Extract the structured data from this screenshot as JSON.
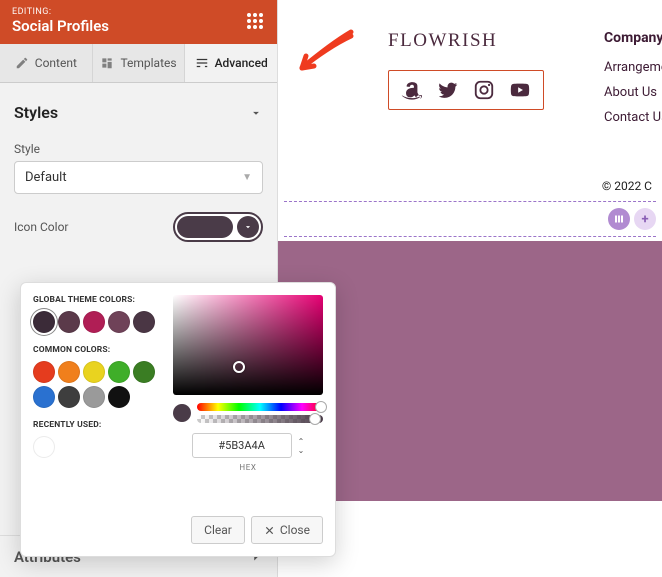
{
  "header": {
    "editing_label": "EDITING:",
    "title": "Social Profiles"
  },
  "tabs": {
    "content": "Content",
    "templates": "Templates",
    "advanced": "Advanced"
  },
  "styles": {
    "section_title": "Styles",
    "style_label": "Style",
    "style_value": "Default",
    "icon_color_label": "Icon Color"
  },
  "attributes": {
    "title": "Attributes"
  },
  "picker": {
    "global_title": "GLOBAL THEME COLORS:",
    "global": [
      "#3b2b38",
      "#5b3a4a",
      "#b01e55",
      "#6f4258",
      "#4a3644"
    ],
    "common_title": "COMMON COLORS:",
    "common": [
      "#e53c1e",
      "#f07f1c",
      "#e9d31f",
      "#3fae29",
      "#3a7d23",
      "#2a71d0",
      "#3e3e3e",
      "#9a9a9a",
      "#111111"
    ],
    "recent_title": "RECENTLY USED:",
    "hex": "#5B3A4A",
    "hex_label": "HEX",
    "clear": "Clear",
    "close": "Close"
  },
  "preview": {
    "brand": "FLOWRISH",
    "company_title": "Company",
    "links": [
      "Arrangements",
      "About Us",
      "Contact Us"
    ],
    "copyright": "© 2022 C"
  }
}
